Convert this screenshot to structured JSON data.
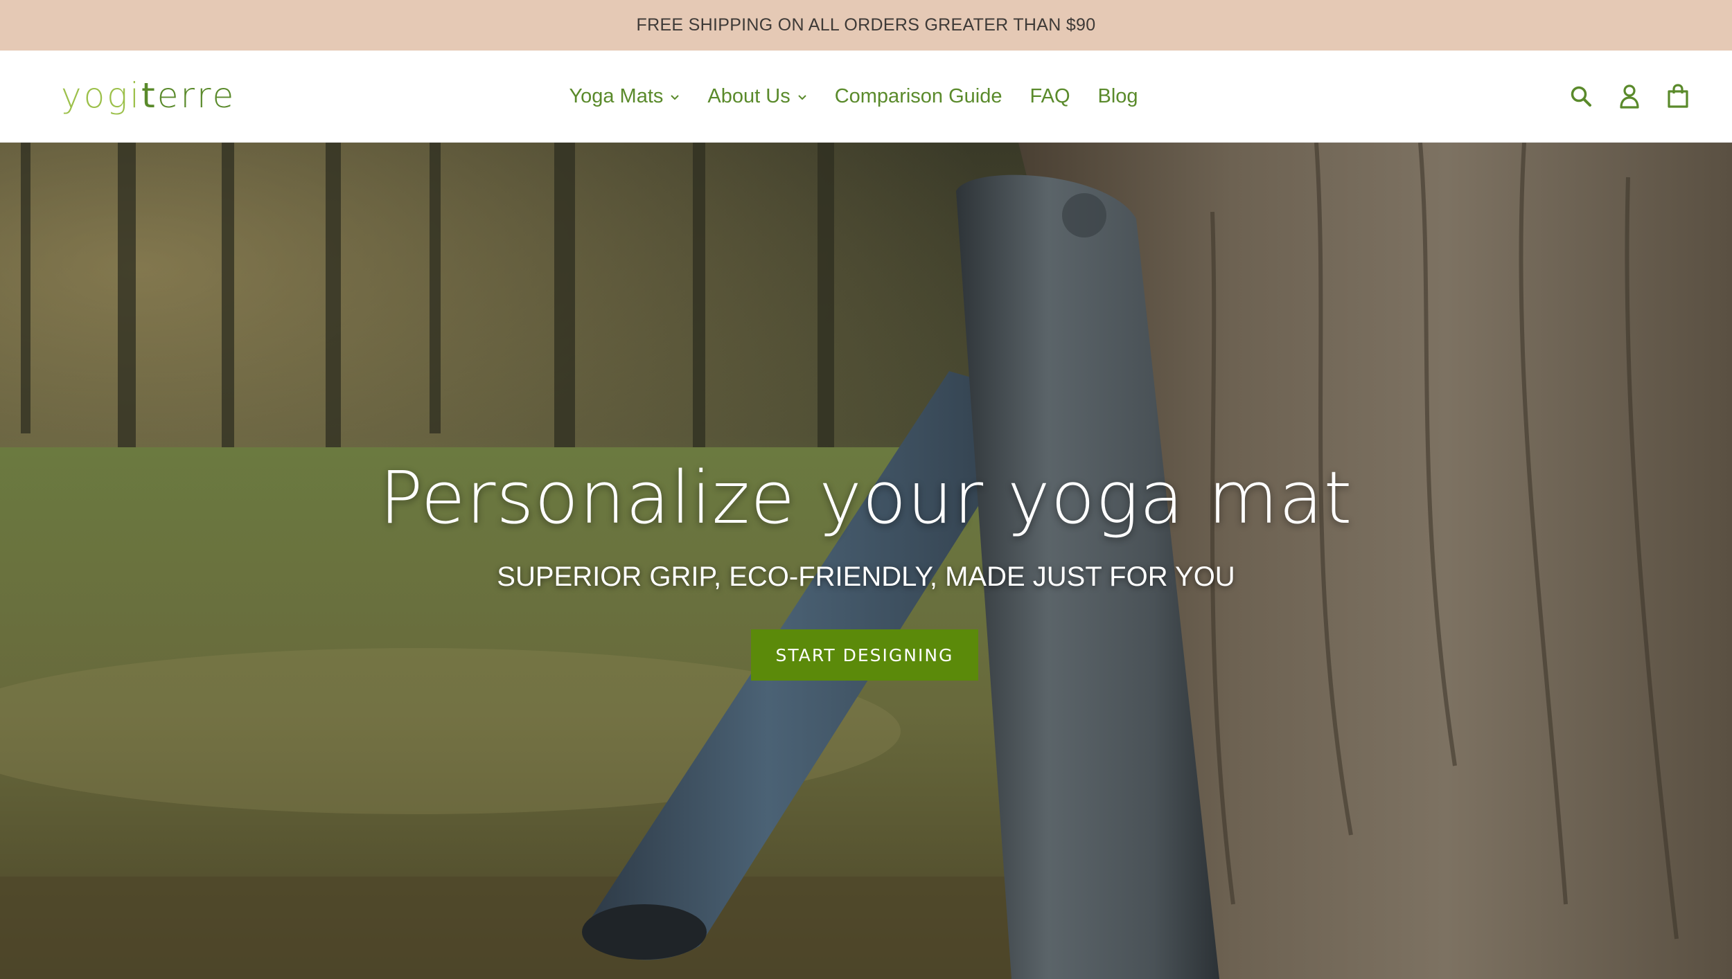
{
  "announcement": {
    "text": "FREE SHIPPING ON ALL ORDERS GREATER THAN $90"
  },
  "header": {
    "logo": {
      "part1": "yogi",
      "cross": "t",
      "part2": "erre"
    },
    "nav": [
      {
        "label": "Yoga Mats",
        "has_dropdown": true
      },
      {
        "label": "About Us",
        "has_dropdown": true
      },
      {
        "label": "Comparison Guide",
        "has_dropdown": false
      },
      {
        "label": "FAQ",
        "has_dropdown": false
      },
      {
        "label": "Blog",
        "has_dropdown": false
      }
    ],
    "icons": [
      "search-icon",
      "account-icon",
      "cart-icon"
    ]
  },
  "hero": {
    "title": "Personalize your yoga mat",
    "subtitle": "SUPERIOR GRIP, ECO-FRIENDLY, MADE JUST FOR YOU",
    "cta_label": "START DESIGNING"
  },
  "colors": {
    "announce_bg": "#e5c9b5",
    "brand_green": "#5a8a2b",
    "logo_light_green": "#9cc04a",
    "cta_bg": "#5b8a0a"
  }
}
